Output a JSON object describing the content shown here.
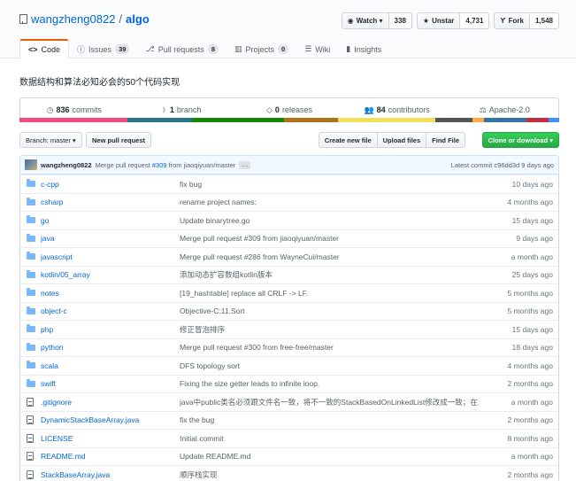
{
  "repo": {
    "owner": "wangzheng0822",
    "separator": "/",
    "name": "algo"
  },
  "actions": [
    {
      "label": "Watch ▾",
      "count": "338",
      "icon": "eye-icon"
    },
    {
      "label": "Unstar",
      "count": "4,731",
      "icon": "star-icon"
    },
    {
      "label": "Fork",
      "count": "1,548",
      "icon": "fork-icon"
    }
  ],
  "tabs": [
    {
      "label": "Code",
      "count": "",
      "icon": "code-icon",
      "selected": true
    },
    {
      "label": "Issues",
      "count": "39",
      "icon": "issue-icon"
    },
    {
      "label": "Pull requests",
      "count": "8",
      "icon": "pr-icon"
    },
    {
      "label": "Projects",
      "count": "0",
      "icon": "project-icon"
    },
    {
      "label": "Wiki",
      "count": "",
      "icon": "wiki-icon"
    },
    {
      "label": "Insights",
      "count": "",
      "icon": "graph-icon"
    }
  ],
  "description": "数据结构和算法必知必会的50个代码实现",
  "summary": {
    "commits": {
      "num": "836",
      "label": "commits"
    },
    "branches": {
      "num": "1",
      "label": "branch"
    },
    "releases": {
      "num": "0",
      "label": "releases"
    },
    "contributors": {
      "num": "84",
      "label": "contributors"
    },
    "license": "Apache-2.0"
  },
  "language_colors": [
    "#f34b7d",
    "#2b7489",
    "#178600",
    "#b07219",
    "#f1e05a",
    "#555555",
    "#ffac45",
    "#3572A5",
    "#c22d40",
    "#438eff",
    "#dea584"
  ],
  "language_shares": [
    0.2,
    0.12,
    0.17,
    0.1,
    0.18,
    0.07,
    0.02,
    0.08,
    0.04,
    0.02
  ],
  "filenav": {
    "branch": "Branch: master ▾",
    "new_pr": "New pull request",
    "create": "Create new file",
    "upload": "Upload files",
    "find": "Find File",
    "clone": "Clone or download ▾"
  },
  "latest_commit": {
    "author": "wangzheng0822",
    "msg_prefix": "Merge pull request",
    "pr": "#309",
    "msg_suffix": "from jiaoqiyuan/master",
    "ellipsis": "…",
    "latest": "Latest commit c96dd3d 9 days ago"
  },
  "files": [
    {
      "type": "dir",
      "name": "c-cpp",
      "msg": "fix bug",
      "age": "10 days ago"
    },
    {
      "type": "dir",
      "name": "csharp",
      "msg": "rename project names:",
      "age": "4 months ago"
    },
    {
      "type": "dir",
      "name": "go",
      "msg": "Update binarytree.go",
      "age": "15 days ago"
    },
    {
      "type": "dir",
      "name": "java",
      "msg": "Merge pull request #309 from jiaoqiyuan/master",
      "age": "9 days ago"
    },
    {
      "type": "dir",
      "name": "javascript",
      "msg": "Merge pull request #286 from WayneCui/master",
      "age": "a month ago"
    },
    {
      "type": "dir",
      "name": "kotlin/05_array",
      "msg": "添加动态扩容数组kotlin版本",
      "age": "25 days ago"
    },
    {
      "type": "dir",
      "name": "notes",
      "msg": "[19_hashtable] replace all CRLF -> LF.",
      "age": "5 months ago"
    },
    {
      "type": "dir",
      "name": "object-c",
      "msg": "Objective-C:11.Sort",
      "age": "5 months ago"
    },
    {
      "type": "dir",
      "name": "php",
      "msg": "修正冒泡排序",
      "age": "15 days ago"
    },
    {
      "type": "dir",
      "name": "python",
      "msg": "Merge pull request #300 from free-free/master",
      "age": "18 days ago"
    },
    {
      "type": "dir",
      "name": "scala",
      "msg": "DFS topology sort",
      "age": "4 months ago"
    },
    {
      "type": "dir",
      "name": "swift",
      "msg": "Fixing the size getter leads to infinite loop.",
      "age": "2 months ago"
    },
    {
      "type": "file",
      "name": ".gitignore",
      "msg": "java中public类名必须跟文件名一致，将不一致的StackBasedOnLinkedList修改成一致；在.gi…",
      "age": "a month ago"
    },
    {
      "type": "file",
      "name": "DynamicStackBaseArray.java",
      "msg": "fix the bug",
      "age": "2 months ago"
    },
    {
      "type": "file",
      "name": "LICENSE",
      "msg": "Initial commit",
      "age": "8 months ago"
    },
    {
      "type": "file",
      "name": "README.md",
      "msg": "Update README.md",
      "age": "a month ago"
    },
    {
      "type": "file",
      "name": "StackBaseArray.java",
      "msg": "顺序栈实现",
      "age": "2 months ago"
    }
  ]
}
